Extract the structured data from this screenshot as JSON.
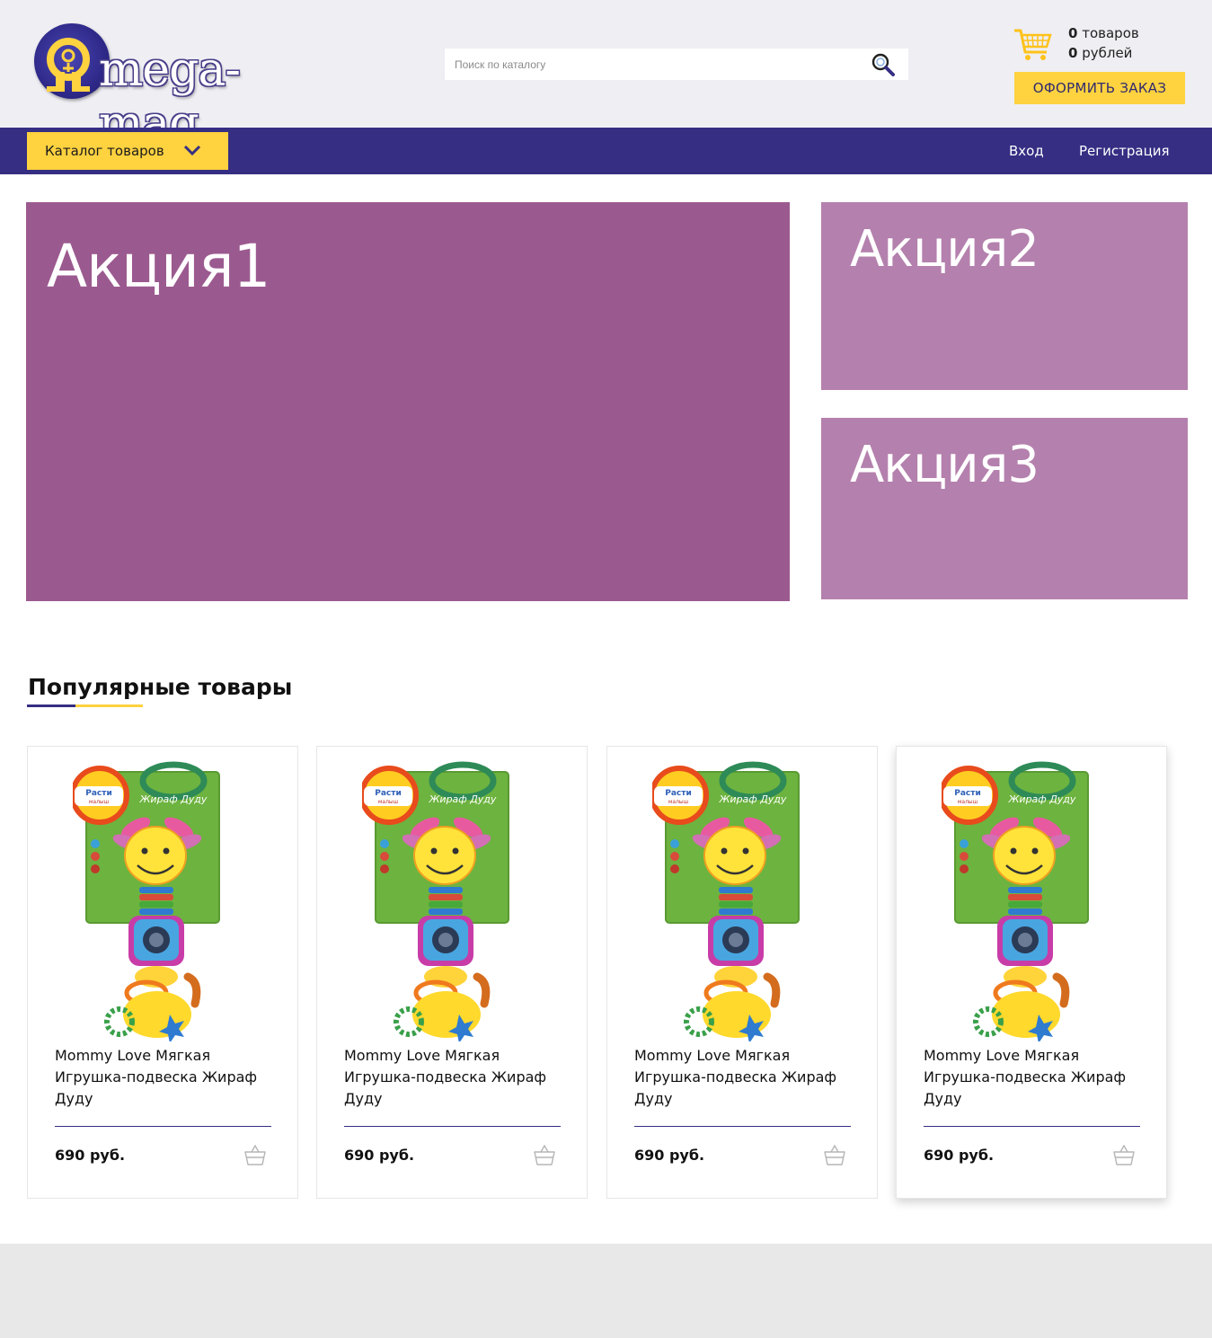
{
  "brand": {
    "logo_text": "mega-mag"
  },
  "search": {
    "placeholder": "Поиск по каталогу"
  },
  "cart": {
    "items_count": "0",
    "items_label": "товаров",
    "sum": "0",
    "sum_label": "рублей",
    "checkout_label": "ОФОРМИТЬ ЗАКАЗ"
  },
  "nav": {
    "catalog_label": "Каталог товаров",
    "login_label": "Вход",
    "register_label": "Регистрация"
  },
  "promos": [
    {
      "label": "Акция1"
    },
    {
      "label": "Акция2"
    },
    {
      "label": "Акция3"
    }
  ],
  "section": {
    "title": "Популярные товары"
  },
  "products": [
    {
      "name": "Mommy Love Мягкая Игрушка-подвеска Жираф Дуду",
      "price": "690 руб.",
      "package_text": "Расти малыш",
      "package_subtitle": "Жираф Дуду"
    },
    {
      "name": "Mommy Love Мягкая Игрушка-подвеска Жираф Дуду",
      "price": "690 руб.",
      "package_text": "Расти малыш",
      "package_subtitle": "Жираф Дуду"
    },
    {
      "name": "Mommy Love Мягкая Игрушка-подвеска Жираф Дуду",
      "price": "690 руб.",
      "package_text": "Расти малыш",
      "package_subtitle": "Жираф Дуду"
    },
    {
      "name": "Mommy Love Мягкая Игрушка-подвеска Жираф Дуду",
      "price": "690 руб.",
      "package_text": "Расти малыш",
      "package_subtitle": "Жираф Дуду"
    }
  ],
  "colors": {
    "accent_yellow": "#ffd23f",
    "brand_navy": "#352e83",
    "promo_main": "#9b5a8f",
    "promo_side": "#b480ad"
  }
}
